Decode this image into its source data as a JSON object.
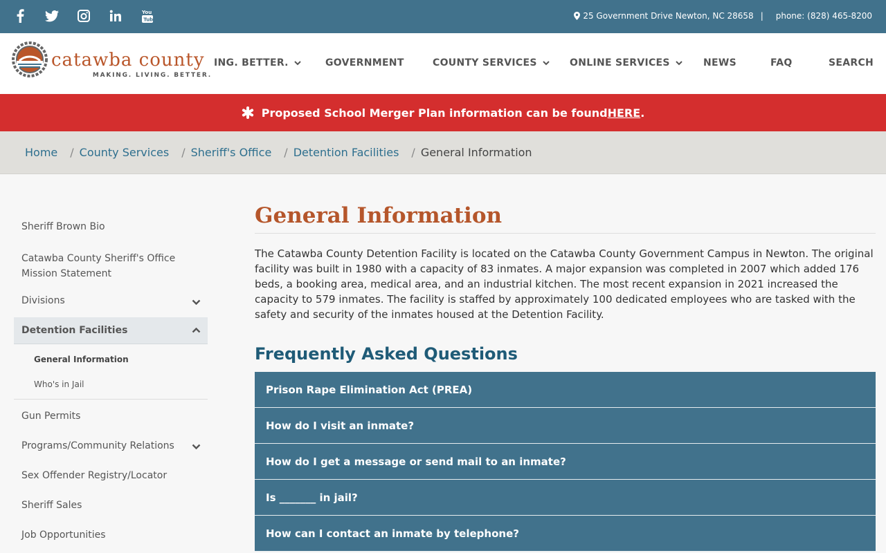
{
  "topbar": {
    "social": [
      "facebook-icon",
      "twitter-icon",
      "instagram-icon",
      "linkedin-icon",
      "youtube-icon"
    ],
    "address": "25 Government Drive Newton, NC 28658",
    "separator": "|",
    "phone": "phone: (828) 465-8200"
  },
  "logo": {
    "name": "catawba county",
    "tagline": "MAKING. LIVING. BETTER."
  },
  "nav": {
    "items": [
      {
        "label": "ING. BETTER."
      },
      {
        "label": "GOVERNMENT"
      },
      {
        "label": "COUNTY SERVICES"
      },
      {
        "label": "ONLINE SERVICES"
      },
      {
        "label": "NEWS"
      },
      {
        "label": "FAQ"
      },
      {
        "label": "SEARCH"
      }
    ]
  },
  "alert": {
    "text": "Proposed School Merger Plan information can be found ",
    "link": "HERE",
    "end": "."
  },
  "breadcrumb": {
    "items": [
      "Home",
      "County Services",
      "Sheriff's Office",
      "Detention Facilities"
    ],
    "separator": "/",
    "current": "General Information"
  },
  "sidebar": {
    "items": [
      {
        "label": "Sheriff Brown Bio"
      },
      {
        "label": "Catawba County Sheriff's Office Mission Statement"
      },
      {
        "label": "Divisions"
      },
      {
        "label": "Detention Facilities"
      },
      {
        "label": "Gun Permits"
      },
      {
        "label": "Programs/Community Relations"
      },
      {
        "label": "Sex Offender Registry/Locator"
      },
      {
        "label": "Sheriff Sales"
      },
      {
        "label": "Job Opportunities"
      }
    ],
    "sub_items": [
      {
        "label": "General Information"
      },
      {
        "label": "Who's in Jail"
      }
    ]
  },
  "main": {
    "title": "General Information",
    "intro": "The Catawba County Detention Facility is located on the Catawba County Government Campus in Newton. The original facility was built in 1980 with a capacity of 83 inmates. A major expansion was completed in 2007 which added 176 beds, a booking area, medical area, and an industrial kitchen. The most recent expansion in 2021 increased the capacity to 579 inmates. The facility is staffed by approximately 100 dedicated employees who are tasked with the safety and security of the inmates housed at the Detention Facility.",
    "faq_title": "Frequently Asked Questions",
    "faq": [
      "Prison Rape Elimination Act (PREA)",
      "How do I visit an inmate?",
      "How do I get a message or send mail to an inmate?",
      "Is _______ in jail?",
      "How can I contact an inmate by telephone?"
    ]
  },
  "colors": {
    "topbar": "#41728c",
    "alert": "#d42e2e",
    "title": "#b5562b",
    "link": "#2e6f8e"
  }
}
